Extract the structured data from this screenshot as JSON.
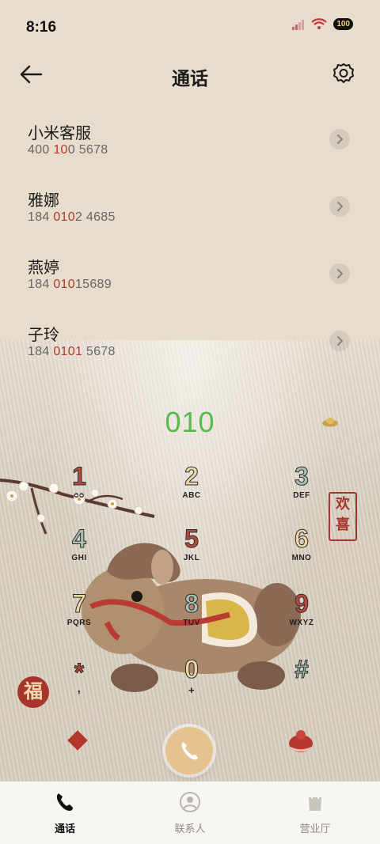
{
  "status_bar": {
    "time": "8:16",
    "battery": "100"
  },
  "header": {
    "title": "通话"
  },
  "calls": [
    {
      "name": "小米客服",
      "num_a": "400 ",
      "num_b": "10",
      "num_c": "0 5678"
    },
    {
      "name": "雅娜",
      "num_a": "184 ",
      "num_b": "010",
      "num_c": "2 4685"
    },
    {
      "name": "燕婷",
      "num_a": "184 ",
      "num_b": "010",
      "num_c": "15689"
    },
    {
      "name": "子玲",
      "num_a": "184 ",
      "num_b": "0101",
      "num_c": " 5678"
    }
  ],
  "dialer": {
    "input": "010",
    "keys": [
      {
        "digit": "1",
        "letters": "ᴑᴑ",
        "color": "#b24a3e"
      },
      {
        "digit": "2",
        "letters": "ABC",
        "color": "#ecd8a6"
      },
      {
        "digit": "3",
        "letters": "DEF",
        "color": "#aabfb5"
      },
      {
        "digit": "4",
        "letters": "GHI",
        "color": "#a9c0b6"
      },
      {
        "digit": "5",
        "letters": "JKL",
        "color": "#b8483b"
      },
      {
        "digit": "6",
        "letters": "MNO",
        "color": "#ecd8a6"
      },
      {
        "digit": "7",
        "letters": "PQRS",
        "color": "#ecd8a6"
      },
      {
        "digit": "8",
        "letters": "TUV",
        "color": "#a9c0b6"
      },
      {
        "digit": "9",
        "letters": "WXYZ",
        "color": "#b8483b"
      },
      {
        "digit": "*",
        "letters": ",",
        "color": "#b8483b"
      },
      {
        "digit": "0",
        "letters": "+",
        "color": "#ecd8a6"
      },
      {
        "digit": "#",
        "letters": "",
        "color": "#9fb6ac"
      }
    ]
  },
  "decor": {
    "stamp_text": "欢喜",
    "fu_text": "福"
  },
  "tabs": [
    {
      "label": "通话",
      "active": true
    },
    {
      "label": "联系人",
      "active": false
    },
    {
      "label": "营业厅",
      "active": false
    }
  ],
  "colors": {
    "accent_green": "#5ab94a",
    "highlight_red": "#b23a2a",
    "call_button": "#e4c391"
  }
}
